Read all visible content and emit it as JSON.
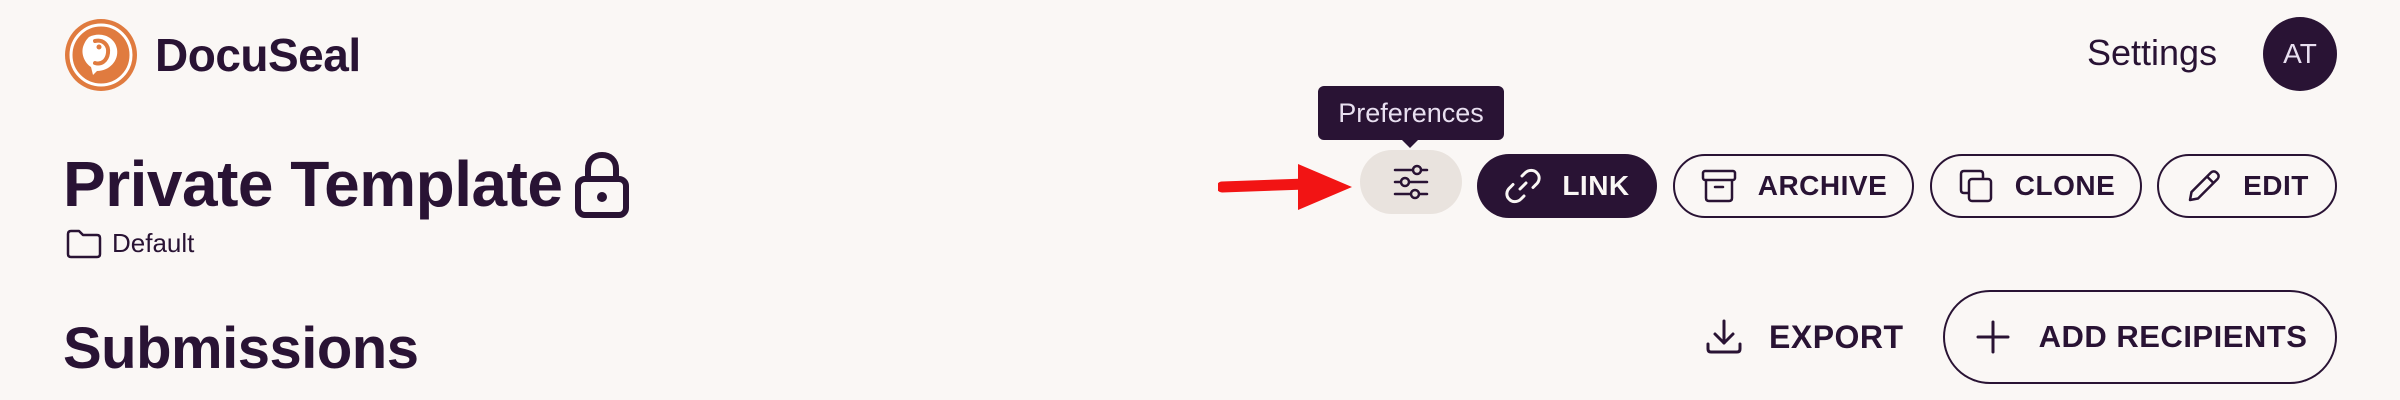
{
  "brand": {
    "name": "DocuSeal",
    "accent": "#e07b3f"
  },
  "nav": {
    "settings": "Settings",
    "avatar_initials": "AT"
  },
  "template": {
    "title": "Private Template",
    "folder": "Default"
  },
  "tooltip": {
    "text": "Preferences"
  },
  "actions": {
    "link": "LINK",
    "archive": "ARCHIVE",
    "clone": "CLONE",
    "edit": "EDIT"
  },
  "submissions": {
    "title": "Submissions",
    "export": "EXPORT",
    "add_recipients": "ADD RECIPIENTS"
  },
  "annotation": {
    "arrow_color": "#f21414"
  }
}
